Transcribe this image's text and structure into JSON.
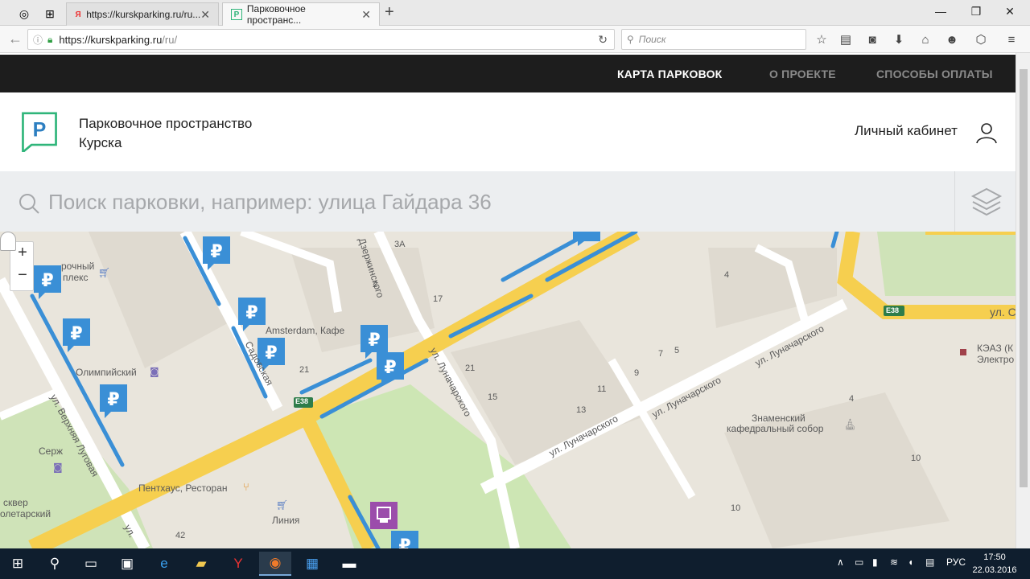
{
  "browser": {
    "tabs": [
      {
        "label": "https://kurskparking.ru/ru...",
        "favicon": "yandex-icon"
      },
      {
        "label": "Парковочное пространс...",
        "favicon": "parking-logo-icon"
      }
    ],
    "url_host": "https://kurskparking.ru",
    "url_path": "/ru/",
    "search_placeholder": "Поиск"
  },
  "topnav": {
    "items": [
      {
        "label": "КАРТА ПАРКОВОК",
        "active": true
      },
      {
        "label": "О ПРОЕКТЕ",
        "active": false
      },
      {
        "label": "СПОСОБЫ ОПЛАТЫ",
        "active": false
      }
    ]
  },
  "header": {
    "title": "Парковочное пространство Курска",
    "account_label": "Личный кабинет"
  },
  "search": {
    "placeholder": "Поиск парковки, например: улица Гайдара 36"
  },
  "map": {
    "labels": [
      {
        "id": "l1",
        "text": "Amsterdam, Кафе"
      },
      {
        "id": "l2",
        "text": "Олимпийский"
      },
      {
        "id": "l3",
        "text": "ул. Луначарского"
      },
      {
        "id": "l4",
        "text": "ул. Луначарского"
      },
      {
        "id": "l5",
        "text": "ул. Луначарского"
      },
      {
        "id": "l6",
        "text": "ул. Луначарского"
      },
      {
        "id": "l7",
        "text": "Знаменский"
      },
      {
        "id": "l8",
        "text": "кафедральный собор"
      },
      {
        "id": "l9",
        "text": "КЭАЗ (К"
      },
      {
        "id": "l10",
        "text": "Электро"
      },
      {
        "id": "l11",
        "text": "Пентхаус, Ресторан"
      },
      {
        "id": "l12",
        "text": "Линия"
      },
      {
        "id": "l13",
        "text": "Серж"
      },
      {
        "id": "l14",
        "text": "сквер"
      },
      {
        "id": "l15",
        "text": "олетарский"
      },
      {
        "id": "l16",
        "text": "ул. Верхняя Луговая"
      },
      {
        "id": "l17",
        "text": "Садовская"
      },
      {
        "id": "l18",
        "text": "Дзержинского"
      },
      {
        "id": "l19",
        "text": "ул. С"
      },
      {
        "id": "l20",
        "text": "рочный"
      },
      {
        "id": "l21",
        "text": "плекс"
      },
      {
        "id": "l22",
        "text": "E38"
      },
      {
        "id": "l23",
        "text": "E38"
      }
    ],
    "house_numbers": [
      "3А",
      "2",
      "17",
      "21",
      "15",
      "21",
      "4",
      "7",
      "5",
      "9",
      "11",
      "13",
      "4",
      "10",
      "10",
      "42",
      "ул."
    ]
  },
  "taskbar": {
    "lang": "РУС",
    "time": "17:50",
    "date": "22.03.2016"
  },
  "colors": {
    "accent": "#2fb57a",
    "marker": "#3a8fd6",
    "road_major": "#f6cf4f",
    "parking_line": "#3a8fd6"
  }
}
